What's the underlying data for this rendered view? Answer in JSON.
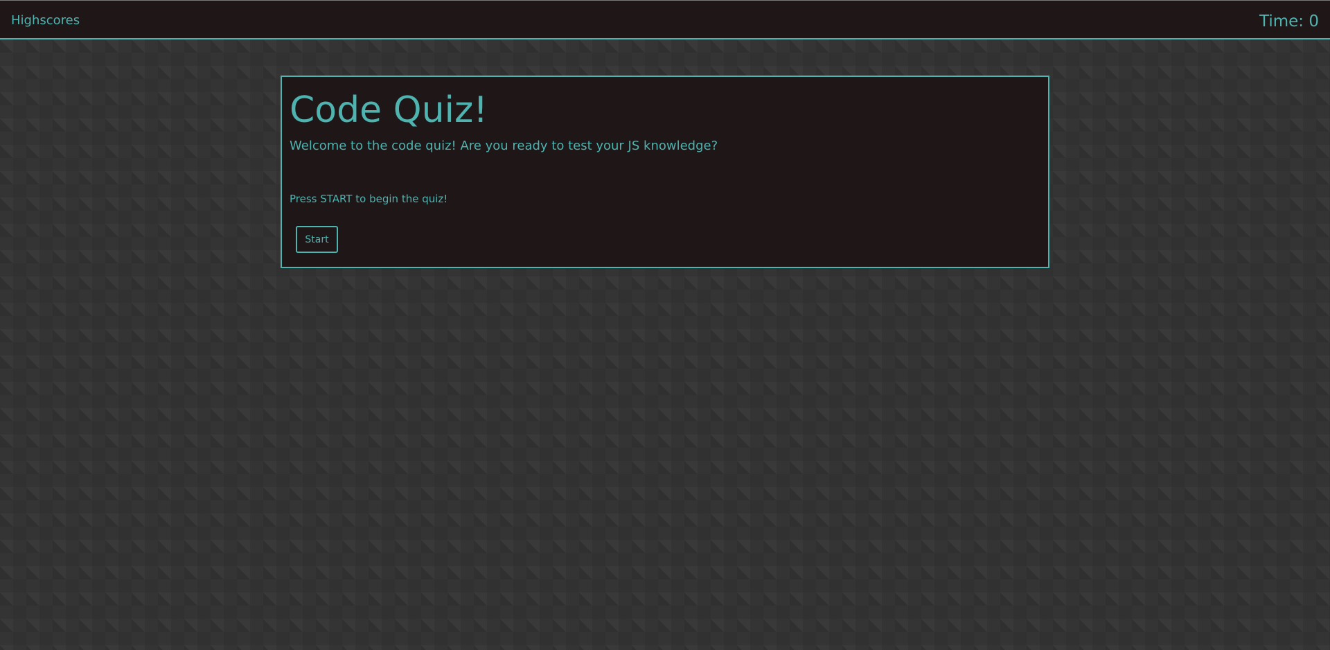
{
  "header": {
    "highscores_label": "Highscores",
    "timer_text": "Time: 0"
  },
  "quiz": {
    "title": "Code Quiz!",
    "subtitle": "Welcome to the code quiz! Are you ready to test your JS knowledge?",
    "instructions": "Press START to begin the quiz!",
    "start_label": "Start"
  },
  "colors": {
    "accent": "#4fb3b0",
    "panel_background": "#1e1617",
    "page_background": "#343434"
  }
}
